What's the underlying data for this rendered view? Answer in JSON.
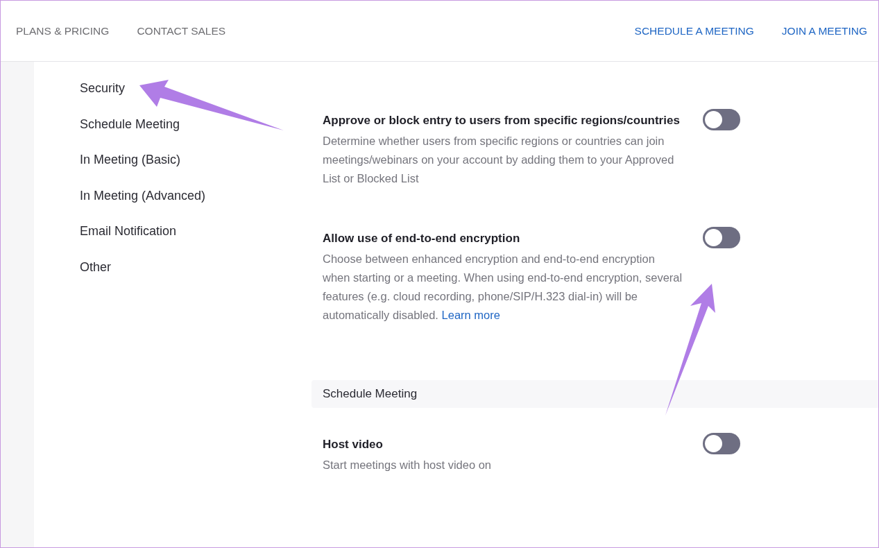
{
  "header": {
    "left_links": [
      "PLANS & PRICING",
      "CONTACT SALES"
    ],
    "right_links": [
      "SCHEDULE A MEETING",
      "JOIN A MEETING"
    ]
  },
  "sidebar": {
    "items": [
      "Security",
      "Schedule Meeting",
      "In Meeting (Basic)",
      "In Meeting (Advanced)",
      "Email Notification",
      "Other"
    ]
  },
  "settings": [
    {
      "kind": "setting",
      "title": "Approve or block entry to users from specific regions/countries",
      "description": "Determine whether users from specific regions or countries can join meetings/webinars on your account by adding them to your Approved List or Blocked List",
      "on": false
    },
    {
      "kind": "setting",
      "title": "Allow use of end-to-end encryption",
      "description": "Choose between enhanced encryption and end-to-end encryption when starting or a meeting. When using end-to-end encryption, several features (e.g. cloud recording, phone/SIP/H.323 dial-in) will be automatically disabled.",
      "link": "Learn more",
      "on": false
    },
    {
      "kind": "section",
      "title": "Schedule Meeting"
    },
    {
      "kind": "setting",
      "title": "Host video",
      "description": "Start meetings with host video on",
      "on": false
    }
  ]
}
